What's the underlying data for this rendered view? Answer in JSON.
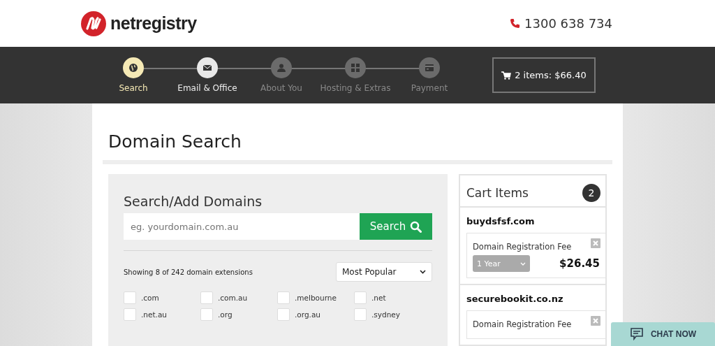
{
  "header": {
    "logo_text": "netregistry",
    "phone": "1300 638 734"
  },
  "steps": [
    {
      "label": "Search",
      "selected": true,
      "completed": false
    },
    {
      "label": "Email & Office",
      "selected": false,
      "completed": true
    },
    {
      "label": "About You",
      "selected": false,
      "completed": false
    },
    {
      "label": "Hosting & Extras",
      "selected": false,
      "completed": false
    },
    {
      "label": "Payment",
      "selected": false,
      "completed": false
    }
  ],
  "cart_button": {
    "label": "2 items: $66.40"
  },
  "page_title": "Domain Search",
  "search_panel": {
    "title": "Search/Add Domains",
    "placeholder": "eg. yourdomain.com.au",
    "button": "Search",
    "showing": "Showing 8 of 242 domain extensions",
    "sort": "Most Popular",
    "extensions": [
      {
        "label": ".com",
        "checked": false
      },
      {
        "label": ".com.au",
        "checked": false
      },
      {
        "label": ".melbourne",
        "checked": false
      },
      {
        "label": ".net",
        "checked": false
      },
      {
        "label": ".net.au",
        "checked": false
      },
      {
        "label": ".org",
        "checked": false
      },
      {
        "label": ".org.au",
        "checked": false
      },
      {
        "label": ".sydney",
        "checked": false
      }
    ]
  },
  "cart": {
    "title": "Cart Items",
    "count": "2",
    "items": [
      {
        "domain": "buydsfsf.com",
        "fee": "Domain Registration Fee",
        "term": "1 Year",
        "price": "$26.45"
      },
      {
        "domain": "securebookit.co.nz",
        "fee": "Domain Registration Fee"
      }
    ]
  },
  "chat_button": "CHAT NOW"
}
